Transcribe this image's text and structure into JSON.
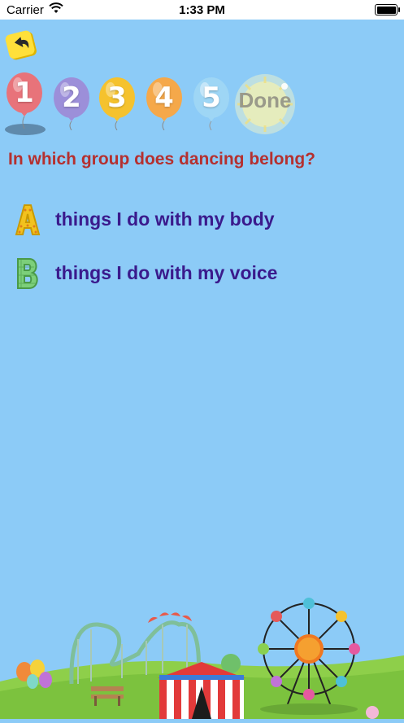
{
  "status_bar": {
    "carrier": "Carrier",
    "time": "1:33 PM"
  },
  "back_button_icon": "back-arrow-icon",
  "progress": {
    "steps": [
      "1",
      "2",
      "3",
      "4",
      "5"
    ],
    "current_step": 1,
    "done_label": "Done",
    "colors": [
      "#e8737a",
      "#9c8fd9",
      "#f5c22e",
      "#f5a84a",
      "#9ed6f5"
    ]
  },
  "question": "In which group does dancing belong?",
  "answers": [
    {
      "letter": "A",
      "text": "things I do with my body",
      "color": "#f2c21e"
    },
    {
      "letter": "B",
      "text": "things I do with my voice",
      "color": "#7ccf7a"
    }
  ],
  "colors": {
    "background": "#8ccbf7",
    "question": "#b5302f",
    "answer_text": "#3a1a8c"
  }
}
